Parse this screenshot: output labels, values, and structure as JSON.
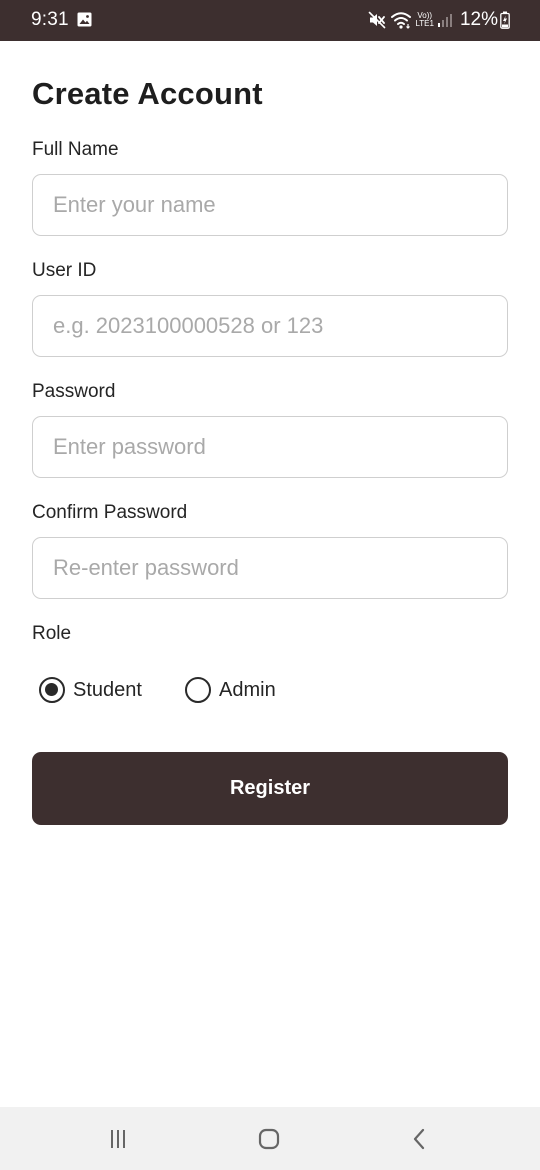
{
  "status_bar": {
    "time": "9:31",
    "volte_line1": "Vo))",
    "volte_line2": "LTE1",
    "battery": "12%",
    "icons": [
      "gallery-icon",
      "mute-icon",
      "wifi-icon",
      "signal-icon",
      "battery-charging-icon"
    ]
  },
  "form": {
    "title": "Create Account",
    "fields": [
      {
        "label": "Full Name",
        "placeholder": "Enter your name",
        "value": ""
      },
      {
        "label": "User ID",
        "placeholder": "e.g. 2023100000528 or 123",
        "value": ""
      },
      {
        "label": "Password",
        "placeholder": "Enter password",
        "value": ""
      },
      {
        "label": "Confirm Password",
        "placeholder": "Re-enter password",
        "value": ""
      }
    ],
    "role": {
      "label": "Role",
      "options": [
        "Student",
        "Admin"
      ],
      "selected": "Student"
    },
    "submit_label": "Register"
  },
  "nav_bar": {
    "icons": [
      "recent-apps-icon",
      "home-icon",
      "back-icon"
    ]
  },
  "colors": {
    "primary": "#3d2f2f",
    "background": "#ffffff",
    "input_border": "#cfcfcf",
    "placeholder": "#a9a9a9",
    "nav_background": "#f1f1f1"
  }
}
